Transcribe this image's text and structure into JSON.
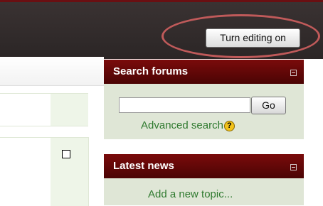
{
  "header": {
    "edit_button_label": "Turn editing on"
  },
  "search_block": {
    "title": "Search forums",
    "search_value": "",
    "go_label": "Go",
    "advanced_link": "Advanced search",
    "help_icon_glyph": "?"
  },
  "news_block": {
    "title": "Latest news",
    "add_topic_link": "Add a new topic..."
  },
  "colors": {
    "block_header": "#6a0606",
    "block_body": "#dfe6d6",
    "link_green": "#2f7a2f",
    "annotation": "#c05a5a"
  }
}
